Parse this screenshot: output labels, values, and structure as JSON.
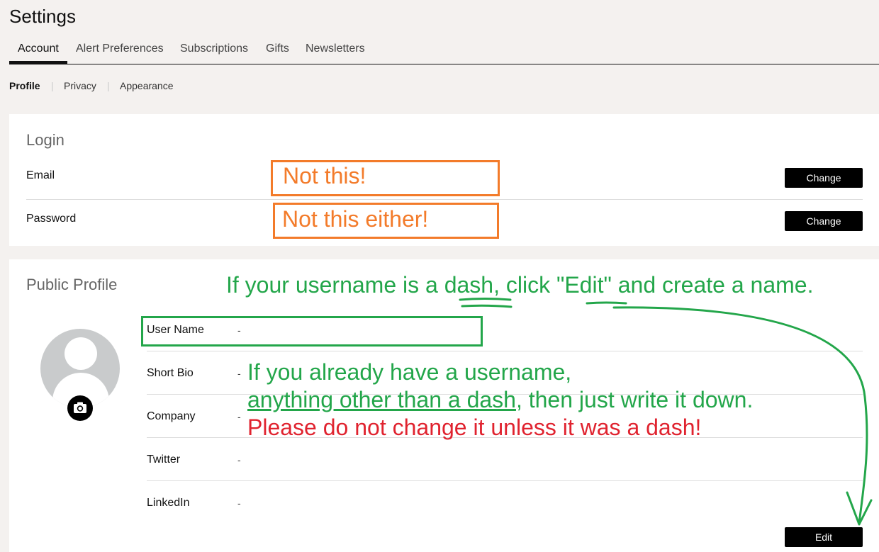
{
  "page": {
    "title": "Settings"
  },
  "tabs": [
    "Account",
    "Alert Preferences",
    "Subscriptions",
    "Gifts",
    "Newsletters"
  ],
  "subnav": [
    "Profile",
    "Privacy",
    "Appearance"
  ],
  "login": {
    "title": "Login",
    "email_label": "Email",
    "password_label": "Password",
    "change_label": "Change"
  },
  "profile": {
    "title": "Public Profile",
    "fields": [
      {
        "label": "User Name",
        "value": "-"
      },
      {
        "label": "Short Bio",
        "value": "-"
      },
      {
        "label": "Company",
        "value": "-"
      },
      {
        "label": "Twitter",
        "value": "-"
      },
      {
        "label": "LinkedIn",
        "value": "-"
      }
    ],
    "edit_label": "Edit"
  },
  "annotations": {
    "not_this": "Not this!",
    "not_this_either": "Not this either!",
    "instruction_prefix": "If your username is a ",
    "instruction_dash": "dash",
    "instruction_mid": ", click ",
    "instruction_edit": "\"Edit\"",
    "instruction_suffix": " and create a name.",
    "already_line1": "If you already have a username,",
    "already_line2_underlined": "anything other than a dash",
    "already_line2_rest": ", then just write it down.",
    "warning": "Please do not change it unless it was a dash!",
    "colors": {
      "orange": "#f37b2a",
      "green": "#23a64a",
      "red": "#e0232f"
    }
  }
}
